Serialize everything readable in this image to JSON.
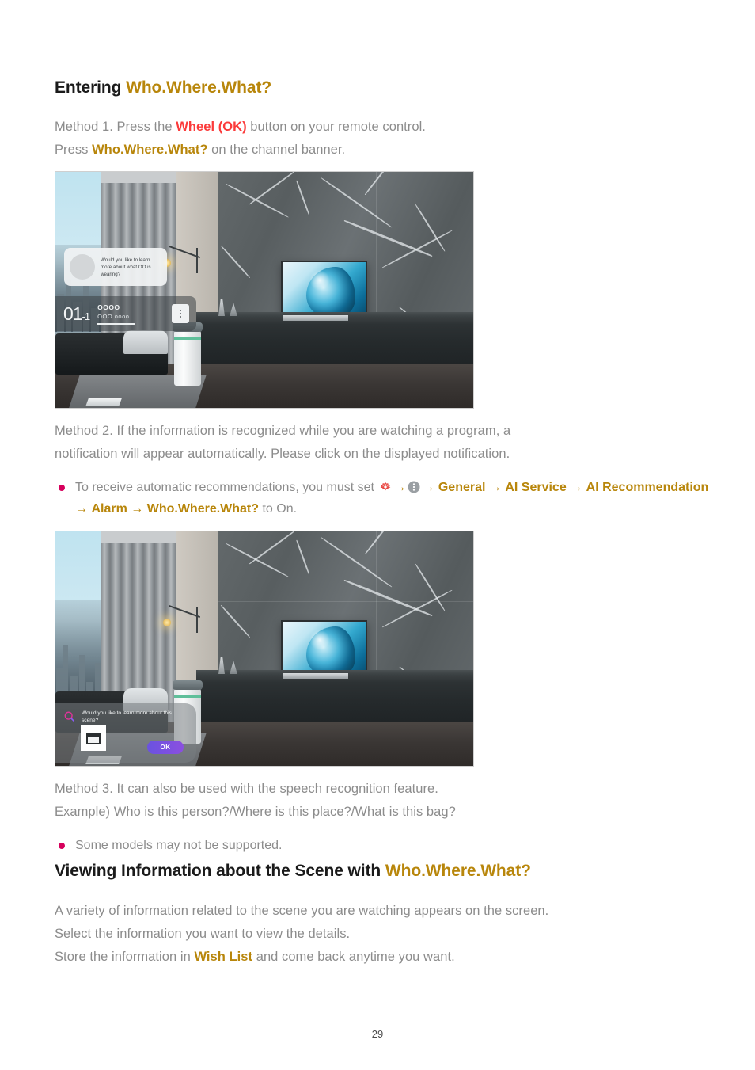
{
  "document": {
    "page_number": "29"
  },
  "colors": {
    "gold": "#b8860b",
    "red": "#fb3b3b",
    "bullet_pink": "#d6005c",
    "body_gray": "#8c8c8c",
    "heading_black": "#1a1a1a",
    "ok_button_purple": "#7a50e0"
  },
  "section1": {
    "title_prefix": "Entering ",
    "title_highlight": "Who.Where.What?",
    "method1": {
      "line1_a": "Method 1. Press the ",
      "line1_highlight": "Wheel (OK)",
      "line1_b": " button on your remote control.",
      "line2_a": "Press ",
      "line2_highlight": "Who.Where.What?",
      "line2_b": " on the channel banner."
    },
    "figure1": {
      "caption": "TV living room with channel banner and recommendation bubble",
      "notification_text": "Would you like to learn more about what OO is wearing?",
      "channel_number": "01",
      "channel_sub": "-1",
      "channel_title": "OOOO",
      "channel_info": "OOO oooo",
      "more_options_icon": "vertical-dots-icon"
    },
    "method2": {
      "line1": "Method 2. If the information is recognized while you are watching a program, a",
      "line2": "notification will appear automatically. Please click on the displayed notification."
    },
    "bullet1": {
      "text_a": "To receive automatic recommendations, you must set ",
      "icon1": "settings-gear-icon",
      "arrow": "→",
      "icon2": "more-options-icon",
      "path": [
        "General",
        "AI Service",
        "AI Recommendation",
        "Alarm",
        "Who.Where.What?"
      ],
      "text_b": " to On."
    },
    "figure2": {
      "caption": "TV living room with scene recognition card",
      "notification_text": "Would you like to learn more about this scene?",
      "search_icon": "magnifier-icon",
      "thumbnail_icon": "armchair-thumbnail-icon",
      "ok_label": "OK"
    },
    "method3": {
      "line1": "Method 3. It can also be used with the speech recognition feature.",
      "line2": "Example) Who is this person?/Where is this place?/What is this bag?"
    },
    "bullet2": {
      "text": "Some models may not be supported."
    }
  },
  "section2": {
    "title_prefix": "Viewing Information about the Scene with ",
    "title_highlight": "Who.Where.What?",
    "body": {
      "line1": "A variety of information related to the scene you are watching appears on the screen.",
      "line2": "Select the information you want to view the details.",
      "line3_a": "Store the information in ",
      "line3_highlight": "Wish List",
      "line3_b": " and come back anytime you want."
    }
  }
}
